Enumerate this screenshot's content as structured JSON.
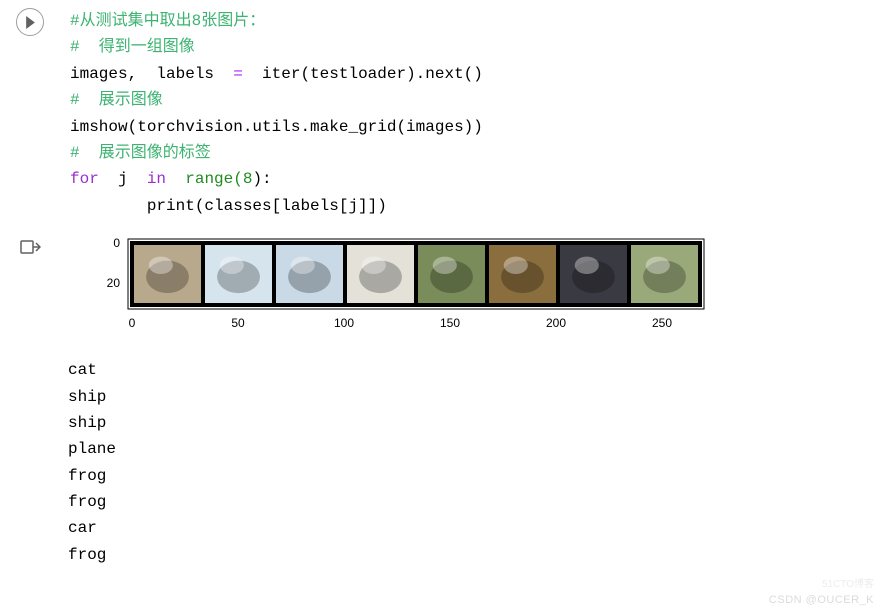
{
  "code": {
    "c1": "#从测试集中取出8张图片：",
    "c2": "#  得到一组图像",
    "l3_left": "images,  labels  ",
    "l3_op": "=",
    "l3_right": "  iter(testloader).next()",
    "c4": "#  展示图像",
    "l5": "imshow(torchvision.utils.make_grid(images))",
    "c6": "#  展示图像的标签",
    "l7_for": "for",
    "l7_j": "  j  ",
    "l7_in": "in",
    "l7_range": "  range(",
    "l7_num": "8",
    "l7_end": "):",
    "l8_indent": "        print(classes[labels[j]])"
  },
  "chart_data": {
    "type": "image-grid",
    "x_ticks": [
      "0",
      "50",
      "100",
      "150",
      "200",
      "250"
    ],
    "y_ticks": [
      "0",
      "20"
    ],
    "thumb_width": 32,
    "thumb_height": 32,
    "gap": 2,
    "images": [
      {
        "label": "cat",
        "bg": "#B9A98C"
      },
      {
        "label": "ship",
        "bg": "#D6E4EE"
      },
      {
        "label": "ship",
        "bg": "#C9D9E5"
      },
      {
        "label": "plane",
        "bg": "#E3E1D8"
      },
      {
        "label": "frog",
        "bg": "#7A8C5A"
      },
      {
        "label": "frog",
        "bg": "#8B6E3E"
      },
      {
        "label": "car",
        "bg": "#3A3A42"
      },
      {
        "label": "frog",
        "bg": "#9AA97A"
      }
    ]
  },
  "output": {
    "lines": [
      "cat",
      "ship",
      "ship",
      "plane",
      "frog",
      "frog",
      "car",
      "frog"
    ]
  },
  "watermark": {
    "line1": "51CTO博客",
    "line2": "CSDN @OUCER_K"
  }
}
